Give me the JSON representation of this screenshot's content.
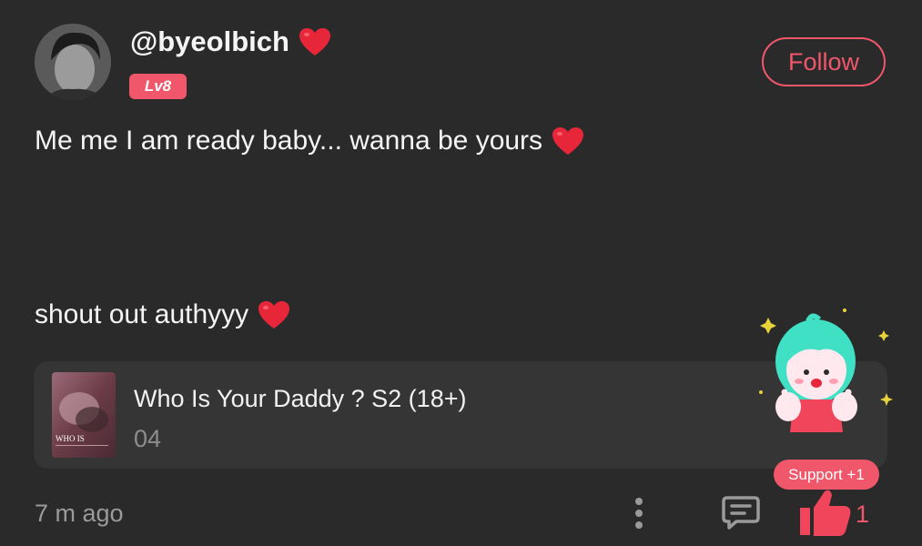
{
  "author": {
    "username": "@byeolbich",
    "level": "Lv8",
    "follow_label": "Follow"
  },
  "post": {
    "line1": "Me me I am ready baby... wanna be yours",
    "line2": "shout out authyyy"
  },
  "book": {
    "title": "Who Is Your Daddy ? S2 (18+)",
    "chapter": "04",
    "cover_text": "WHO IS"
  },
  "footer": {
    "timestamp": "7 m ago",
    "support_label": "Support +1",
    "like_count": "1"
  },
  "colors": {
    "background": "#2a2a2b",
    "card": "#353536",
    "accent": "#f1576a",
    "heart": "#e8263a",
    "muted": "#9a9a9a"
  },
  "icons": {
    "heart": "heart-icon",
    "more": "more-vertical-icon",
    "comment": "comment-icon",
    "like": "thumbs-up-icon"
  }
}
